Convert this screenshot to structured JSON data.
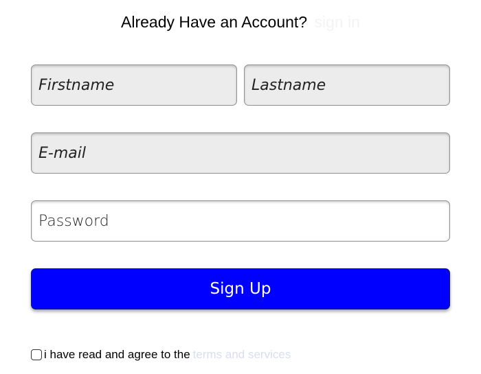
{
  "header": {
    "question": "Already Have an Account?",
    "signin_link": "sign in"
  },
  "form": {
    "firstname_placeholder": "Firstname",
    "lastname_placeholder": "Lastname",
    "email_placeholder": "E-mail",
    "password_placeholder": "Password",
    "signup_label": "Sign Up"
  },
  "terms": {
    "checked": false,
    "text": "i have read and agree to the",
    "link": "terms and services"
  },
  "colors": {
    "signup_button": "#0000ff",
    "input_background": "#ececec",
    "signin_link": "#f3f3f3",
    "terms_link": "#dadcf2"
  }
}
